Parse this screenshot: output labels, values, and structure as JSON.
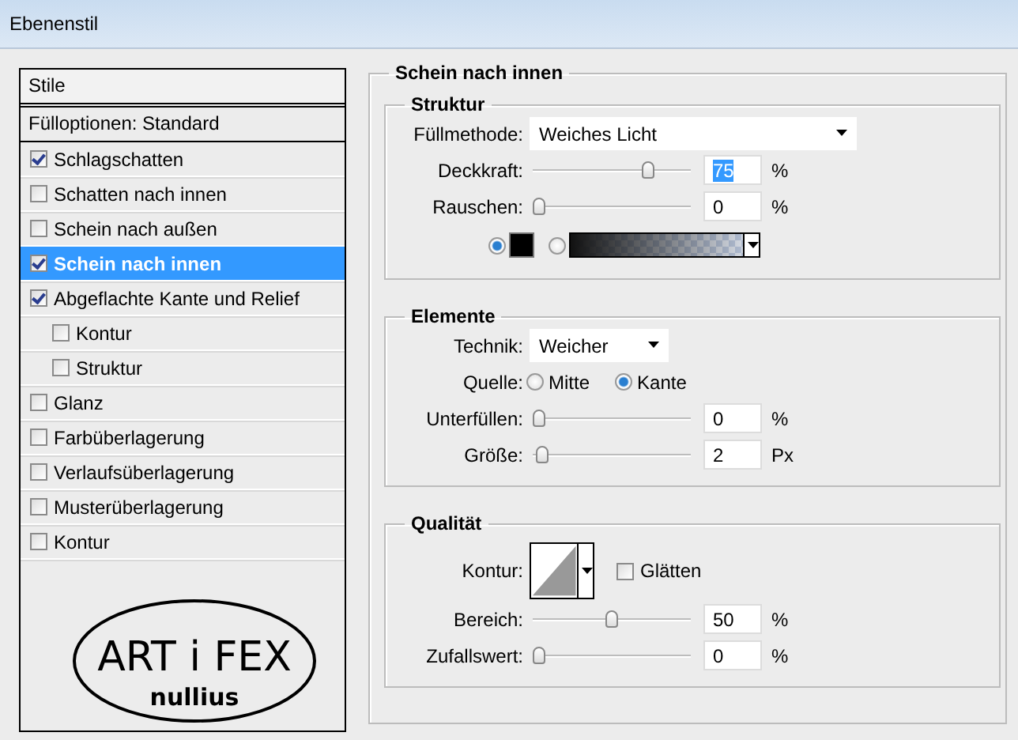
{
  "window": {
    "title": "Ebenenstil"
  },
  "styles_panel": {
    "header": "Stile",
    "blend_options": "Fülloptionen: Standard",
    "items": [
      {
        "label": "Schlagschatten",
        "checked": true,
        "selected": false
      },
      {
        "label": "Schatten nach innen",
        "checked": false,
        "selected": false
      },
      {
        "label": "Schein nach außen",
        "checked": false,
        "selected": false
      },
      {
        "label": "Schein nach innen",
        "checked": true,
        "selected": true
      },
      {
        "label": "Abgeflachte Kante und Relief",
        "checked": true,
        "selected": false,
        "children": [
          {
            "label": "Kontur",
            "checked": false,
            "selected": false
          },
          {
            "label": "Struktur",
            "checked": false,
            "selected": false
          }
        ]
      },
      {
        "label": "Glanz",
        "checked": false,
        "selected": false
      },
      {
        "label": "Farbüberlagerung",
        "checked": false,
        "selected": false
      },
      {
        "label": "Verlaufsüberlagerung",
        "checked": false,
        "selected": false
      },
      {
        "label": "Musterüberlagerung",
        "checked": false,
        "selected": false
      },
      {
        "label": "Kontur",
        "checked": false,
        "selected": false
      }
    ],
    "logo": {
      "line_1": "ART i FEX",
      "line_2": "nullius"
    }
  },
  "settings": {
    "title": "Schein nach innen",
    "groups": [
      {
        "title": "Struktur",
        "rows": [
          {
            "kind": "dropdown",
            "label": "Füllmethode:",
            "value": "Weiches Licht"
          },
          {
            "kind": "slider",
            "label": "Deckkraft:",
            "level": 0.75,
            "value": "75",
            "value_selected": true,
            "unit": "%"
          },
          {
            "kind": "slider",
            "label": "Rauschen:",
            "level": 0,
            "value": "0",
            "value_selected": false,
            "unit": "%"
          },
          {
            "kind": "fill_source",
            "options": [
              {
                "kind": "color",
                "selected": true
              },
              {
                "kind": "gradient",
                "selected": false
              }
            ]
          }
        ]
      },
      {
        "title": "Elemente",
        "rows": [
          {
            "kind": "dropdown_short",
            "label": "Technik:",
            "value": "Weicher"
          },
          {
            "kind": "radio",
            "label": "Quelle:",
            "options": [
              {
                "label": "Mitte",
                "selected": false
              },
              {
                "label": "Kante",
                "selected": true
              }
            ]
          },
          {
            "kind": "slider",
            "label": "Unterfüllen:",
            "level": 0,
            "value": "0",
            "value_selected": false,
            "unit": "%"
          },
          {
            "kind": "slider",
            "label": "Größe:",
            "level": 0.02,
            "value": "2",
            "value_selected": false,
            "unit": "Px"
          }
        ]
      },
      {
        "title": "Qualität",
        "rows": [
          {
            "kind": "contour",
            "label": "Kontur:",
            "checkbox": {
              "label": "Glätten",
              "checked": false
            }
          },
          {
            "kind": "slider",
            "label": "Bereich:",
            "level": 0.5,
            "value": "50",
            "value_selected": false,
            "unit": "%"
          },
          {
            "kind": "slider",
            "label": "Zufallswert:",
            "level": 0,
            "value": "0",
            "value_selected": false,
            "unit": "%"
          }
        ]
      }
    ]
  }
}
